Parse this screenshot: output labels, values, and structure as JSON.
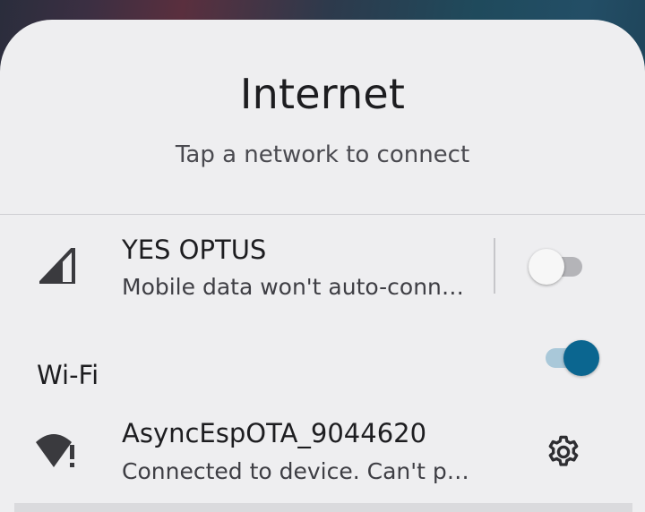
{
  "panel": {
    "title": "Internet",
    "subtitle": "Tap a network to connect"
  },
  "mobile": {
    "name": "YES OPTUS",
    "status": "Mobile data won't auto-conn…",
    "icon": "cellular-signal-icon",
    "toggle_on": false
  },
  "wifi": {
    "label": "Wi-Fi",
    "toggle_on": true
  },
  "networks": [
    {
      "name": "AsyncEspOTA_9044620",
      "status": "Connected to device. Can't p…",
      "icon": "wifi-no-internet-icon",
      "settings_icon": "gear-icon"
    }
  ],
  "colors": {
    "sheet_background": "#eeeef0",
    "accent": "#0b6690",
    "accent_track": "#a9c8d9"
  }
}
